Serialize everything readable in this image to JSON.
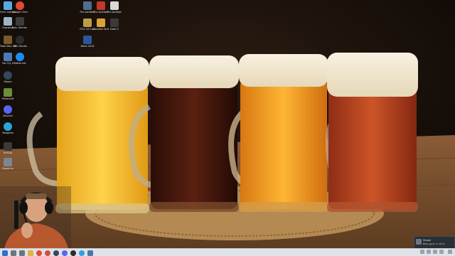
{
  "desktop": {
    "icons_col1": [
      {
        "label": "Этот компьютер",
        "icon": "computer-icon",
        "color": "#5aa7e0"
      },
      {
        "label": "Google Chrome",
        "icon": "chrome-icon",
        "color": "#e5493a"
      },
      {
        "label": "Корзина",
        "icon": "recycle-bin-icon",
        "color": "#9fb3c8"
      },
      {
        "label": "Epic Games Launcher",
        "icon": "epic-icon",
        "color": "#3c3c3c"
      },
      {
        "label": "Total War: WARHAMMER",
        "icon": "game-icon",
        "color": "#7a5a2a"
      },
      {
        "label": "OBS Studio",
        "icon": "obs-icon",
        "color": "#2b2b2b"
      },
      {
        "label": "Far Cry 5",
        "icon": "game-icon",
        "color": "#4b7bb5"
      },
      {
        "label": "Battle.net",
        "icon": "battlenet-icon",
        "color": "#1c8cf0"
      },
      {
        "label": "Steam",
        "icon": "steam-icon",
        "color": "#33475e"
      },
      {
        "label": "Minecraft",
        "icon": "minecraft-icon",
        "color": "#6a8e3a"
      },
      {
        "label": "Discord",
        "icon": "discord-icon",
        "color": "#5865f2"
      },
      {
        "label": "Telegram",
        "icon": "telegram-icon",
        "color": "#2aa3e0"
      },
      {
        "label": "NVIDIA",
        "icon": "nvidia-icon",
        "color": "#3a3a3a"
      },
      {
        "label": "Проекты",
        "icon": "folder-icon",
        "color": "#7d8794"
      }
    ],
    "icons_col2": [
      {
        "label": "The Jackbox Party Pack 4",
        "icon": "game-icon",
        "color": "#4f6d8f"
      },
      {
        "label": "The Jackbox Party Pack 3",
        "icon": "game-icon",
        "color": "#c0392b"
      },
      {
        "label": "The Jackbox Party Pack 2",
        "icon": "game-icon",
        "color": "#d9d9d9"
      },
      {
        "label": "GTA: SA Launcher",
        "icon": "game-icon",
        "color": "#b9a046"
      },
      {
        "label": "Counter-Strike: Global Offe...",
        "icon": "csgo-icon",
        "color": "#d7a33a"
      },
      {
        "label": "Dota 2",
        "icon": "dota-icon",
        "color": "#3a3a3a"
      },
      {
        "label": "Word 2016",
        "icon": "word-icon",
        "color": "#2b579a"
      }
    ]
  },
  "taskbar": {
    "pinned": [
      {
        "icon": "windows-start-icon",
        "color": "#2f6fd1"
      },
      {
        "icon": "search-icon",
        "color": "#6c7480"
      },
      {
        "icon": "task-view-icon",
        "color": "#6c7480"
      },
      {
        "icon": "file-explorer-icon",
        "color": "#e3b341"
      },
      {
        "icon": "chrome-icon",
        "color": "#e5493a"
      },
      {
        "icon": "yandex-icon",
        "color": "#d64d3a"
      },
      {
        "icon": "steam-icon",
        "color": "#33475e"
      },
      {
        "icon": "discord-icon",
        "color": "#5865f2"
      },
      {
        "icon": "obs-icon",
        "color": "#2b2b2b"
      },
      {
        "icon": "telegram-icon",
        "color": "#2aa3e0"
      },
      {
        "icon": "vk-icon",
        "color": "#4a76a8"
      }
    ],
    "clock": ""
  },
  "toast": {
    "title": "Steam",
    "body": "Ваш друг в сети"
  },
  "colors": {
    "taskbar_bg": "#dfe3e8",
    "wood": "#7a5233",
    "beer_light": "#f2b72b",
    "beer_dark": "#3a140c",
    "beer_amber": "#e98f1e",
    "beer_red": "#b3431f"
  }
}
